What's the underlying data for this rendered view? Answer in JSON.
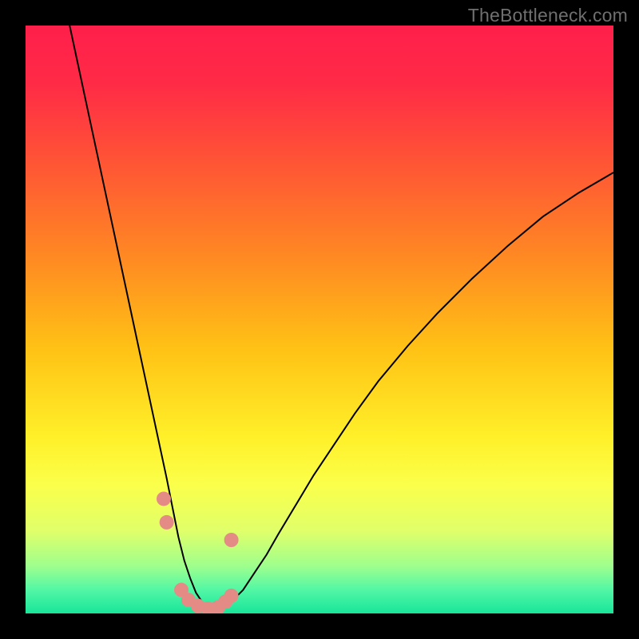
{
  "watermark": "TheBottleneck.com",
  "chart_data": {
    "type": "line",
    "title": "",
    "xlabel": "",
    "ylabel": "",
    "xlim": [
      0,
      100
    ],
    "ylim": [
      0,
      100
    ],
    "grid": false,
    "legend": false,
    "gradient_stops": [
      {
        "offset": 0.0,
        "color": "#ff1f4b"
      },
      {
        "offset": 0.1,
        "color": "#ff2b46"
      },
      {
        "offset": 0.25,
        "color": "#ff5a33"
      },
      {
        "offset": 0.4,
        "color": "#ff8b22"
      },
      {
        "offset": 0.55,
        "color": "#ffc215"
      },
      {
        "offset": 0.7,
        "color": "#fff029"
      },
      {
        "offset": 0.78,
        "color": "#fbff4a"
      },
      {
        "offset": 0.86,
        "color": "#e0ff6a"
      },
      {
        "offset": 0.92,
        "color": "#9dff8d"
      },
      {
        "offset": 0.96,
        "color": "#52f7a5"
      },
      {
        "offset": 1.0,
        "color": "#18e59a"
      }
    ],
    "series": [
      {
        "name": "curve",
        "color": "#000000",
        "width": 2.0,
        "x": [
          7.5,
          9,
          10.5,
          12,
          13.5,
          15,
          16.5,
          18,
          19.5,
          21,
          22.5,
          24,
          25,
          26,
          27,
          28,
          29,
          30,
          31,
          32,
          33,
          34,
          35,
          37,
          39,
          41,
          43,
          46,
          49,
          52,
          56,
          60,
          65,
          70,
          76,
          82,
          88,
          94,
          100
        ],
        "y": [
          100,
          93,
          86,
          79,
          72,
          65,
          58,
          51,
          44,
          37,
          30,
          23,
          18,
          13,
          9,
          6,
          3.5,
          2,
          1,
          0.5,
          0.5,
          1,
          2,
          4,
          7,
          10,
          13.5,
          18.5,
          23.5,
          28,
          34,
          39.5,
          45.5,
          51,
          57,
          62.5,
          67.5,
          71.5,
          75
        ]
      }
    ],
    "markers": {
      "color": "#e58b86",
      "radius_px": 9,
      "points": [
        {
          "x": 23.5,
          "y": 19.5
        },
        {
          "x": 24.0,
          "y": 15.5
        },
        {
          "x": 26.5,
          "y": 4.0
        },
        {
          "x": 27.7,
          "y": 2.3
        },
        {
          "x": 29.3,
          "y": 1.3
        },
        {
          "x": 31.0,
          "y": 0.8
        },
        {
          "x": 32.7,
          "y": 1.0
        },
        {
          "x": 34.0,
          "y": 2.0
        },
        {
          "x": 35.0,
          "y": 3.0
        },
        {
          "x": 35.0,
          "y": 12.5
        }
      ]
    }
  }
}
